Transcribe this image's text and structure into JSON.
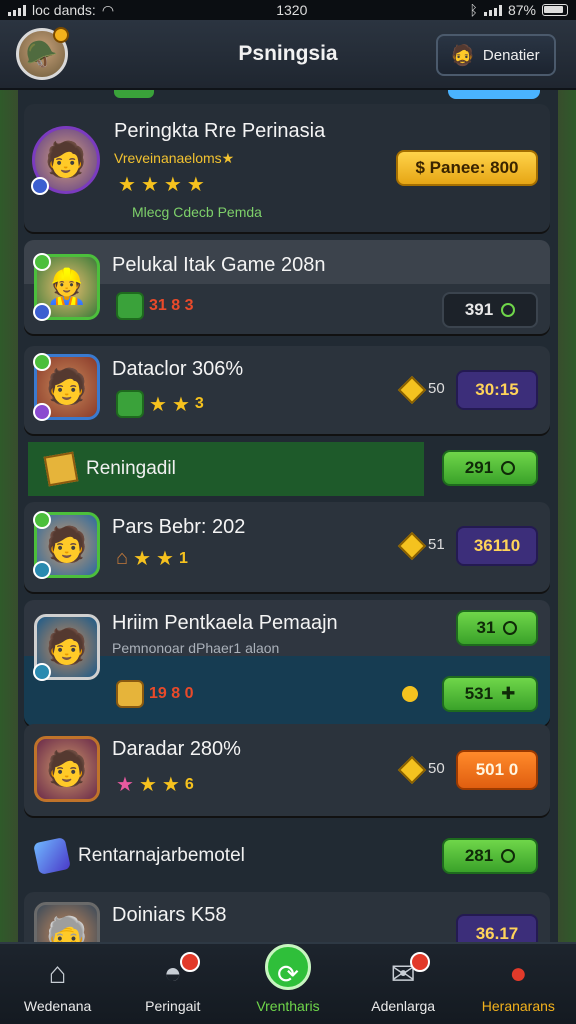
{
  "status_bar": {
    "carrier": "loc dands:",
    "time": "1320",
    "battery": "87%"
  },
  "header": {
    "title": "Psningsia",
    "button_label": "Denatier"
  },
  "cards": [
    {
      "title": "Peringkta Rre Perinasia",
      "subtitle": "Vreveinanaeloms★",
      "note": "Mlecg Cdecb Pemda",
      "pill": "$ Panee: 800"
    },
    {
      "title": "Pelukal Itak Game 208n",
      "stats": "31 8 3",
      "pill": "391"
    },
    {
      "title": "Dataclor 306%",
      "stars_value": "3",
      "diamond_value": "50",
      "pill": "30:15"
    }
  ],
  "green_row": {
    "label": "Reningadil",
    "pill": "291"
  },
  "card4": {
    "title": "Pars Bebr: 202",
    "stars_value": "1",
    "diamond_value": "51",
    "pill": "36110"
  },
  "card5": {
    "title": "Hriim Pentkaela Pemaajn",
    "subtitle": "Pemnonoar dPhaer1 alaon",
    "pill_top": "31",
    "stats": "19 8 0",
    "pill_bottom": "531"
  },
  "card6": {
    "title": "Daradar 280%",
    "stars_value": "6",
    "diamond_value": "50",
    "pill": "501 0"
  },
  "plain_row": {
    "label": "Rentarnajarbemotel",
    "pill": "281"
  },
  "card7": {
    "title": "Doiniars K58",
    "pill": "36.17"
  },
  "nav": [
    {
      "label": "Wedenana",
      "icon": "home-icon"
    },
    {
      "label": "Peringait",
      "icon": "helmet-icon"
    },
    {
      "label": "Vrentharis",
      "icon": "refresh-icon"
    },
    {
      "label": "Adenlarga",
      "icon": "mail-icon"
    },
    {
      "label": "Heranarans",
      "icon": "trophy-icon"
    }
  ],
  "colors": {
    "accent_green": "#3aa22a",
    "accent_yellow": "#f6c21e",
    "panel": "#2b333c"
  }
}
